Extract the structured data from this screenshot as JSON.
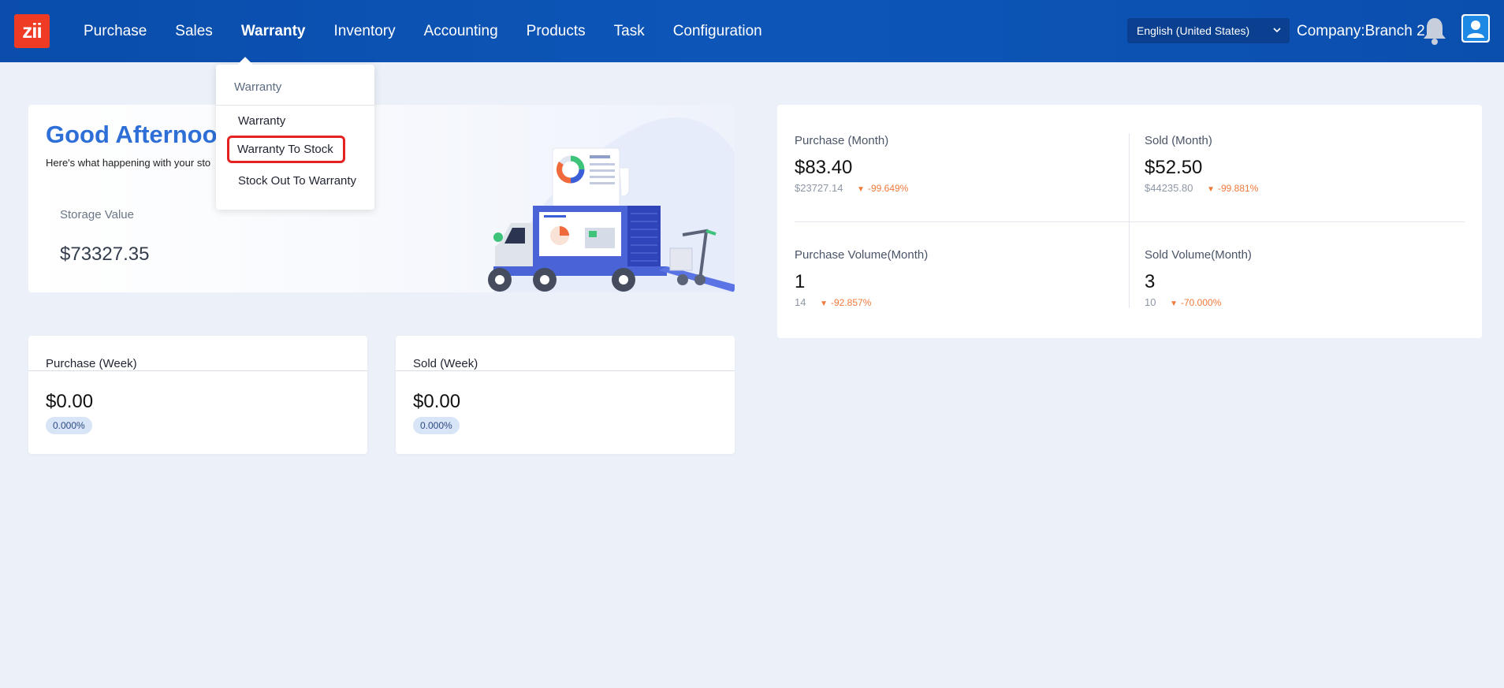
{
  "app": {
    "logo_text": "zii",
    "brand_color": "#ef3b24",
    "nav_color": "#0d56b8"
  },
  "nav": {
    "items": [
      {
        "label": "Purchase"
      },
      {
        "label": "Sales"
      },
      {
        "label": "Warranty",
        "active": true
      },
      {
        "label": "Inventory"
      },
      {
        "label": "Accounting"
      },
      {
        "label": "Products"
      },
      {
        "label": "Task"
      },
      {
        "label": "Configuration"
      }
    ],
    "language": "English (United States)",
    "company": "Company:Branch 2",
    "bell_icon": "bell-icon",
    "avatar_icon": "user-avatar-icon"
  },
  "dropdown": {
    "header": "Warranty",
    "items": [
      {
        "label": "Warranty"
      },
      {
        "label": "Warranty To Stock",
        "highlighted": true
      },
      {
        "label": "Stock Out To Warranty"
      }
    ]
  },
  "greeting": {
    "title": "Good Afternoo",
    "subtitle": "Here's what happening with your sto",
    "storage_label": "Storage Value",
    "storage_value": "$73327.35"
  },
  "week": {
    "purchase": {
      "title": "Purchase (Week)",
      "value": "$0.00",
      "badge": "0.000%"
    },
    "sold": {
      "title": "Sold (Week)",
      "value": "$0.00",
      "badge": "0.000%"
    }
  },
  "stats": {
    "purchase_month": {
      "label": "Purchase (Month)",
      "value": "$83.40",
      "prev": "$23727.14",
      "delta": "-99.649%"
    },
    "sold_month": {
      "label": "Sold (Month)",
      "value": "$52.50",
      "prev": "$44235.80",
      "delta": "-99.881%"
    },
    "purchase_volume": {
      "label": "Purchase Volume(Month)",
      "value": "1",
      "prev": "14",
      "delta": "-92.857%"
    },
    "sold_volume": {
      "label": "Sold Volume(Month)",
      "value": "3",
      "prev": "10",
      "delta": "-70.000%"
    },
    "delta_color": "#f07a3b"
  }
}
